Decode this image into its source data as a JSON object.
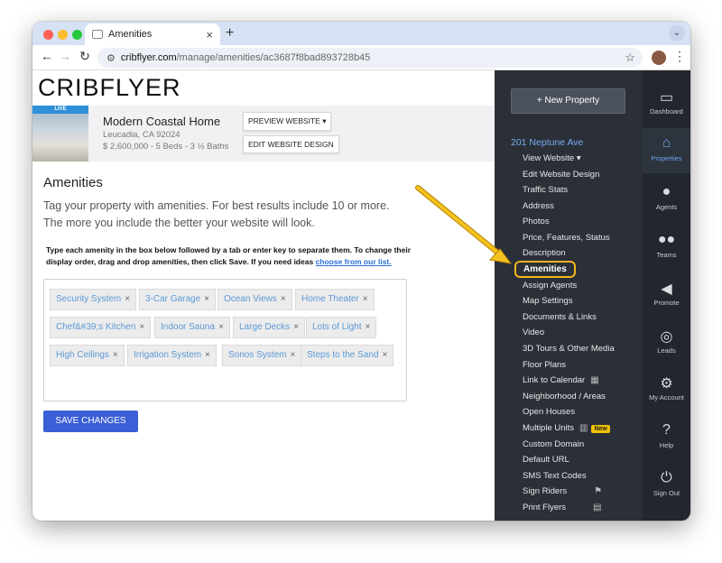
{
  "browser": {
    "tab_title": "Amenities",
    "new_tab": "+",
    "url_host": "cribflyer.com",
    "url_path": "/manage/amenities/ac3687f8bad893728b45"
  },
  "brand": {
    "logo": "CRIBFLYER"
  },
  "property": {
    "badge": "LIVE",
    "name": "Modern Coastal Home",
    "location": "Leucadia, CA 92024",
    "details": "$ 2,600,000 - 5 Beds - 3 ½ Baths",
    "preview_btn": "PREVIEW WEBSITE",
    "edit_btn": "EDIT WEBSITE DESIGN"
  },
  "content": {
    "heading": "Amenities",
    "intro": "Tag your property with amenities. For best results include 10 or more. The more you include the better your website will look.",
    "instructions": "Type each amenity in the box below followed by a tab or enter key to separate them. To change their display order, drag and drop amenities, then click Save. If you need ideas",
    "ideas_link": "choose from our list.",
    "tags": [
      "Security System",
      "3-Car Garage",
      "Ocean Views",
      "Home Theater",
      "Chef&#39;s Kitchen",
      "Indoor Sauna",
      "Large Decks",
      "Lots of Light",
      "High Ceilings",
      "Irrigation System",
      "Sonos System",
      "Steps to the Sand"
    ],
    "tag_remove": "×",
    "save_label": "SAVE CHANGES"
  },
  "sidebar": {
    "new_property": "+ New Property",
    "address": "201 Neptune Ave",
    "items": [
      "View Website",
      "Edit Website Design",
      "Traffic Stats",
      "Address",
      "Photos",
      "Price, Features, Status",
      "Description",
      "Amenities",
      "Assign Agents",
      "Map Settings",
      "Documents & Links",
      "Video",
      "3D Tours & Other Media",
      "Floor Plans",
      "Link to Calendar",
      "Neighborhood / Areas",
      "Open Houses",
      "Multiple Units",
      "Custom Domain",
      "Default URL",
      "SMS Text Codes",
      "Sign Riders",
      "Print Flyers"
    ],
    "new_badge": "New",
    "active_item": "Amenities"
  },
  "rail": [
    "Dashboard",
    "Properties",
    "Agents",
    "Teams",
    "Promote",
    "Leads",
    "My Account",
    "Help",
    "Sign Out"
  ],
  "colors": {
    "accent": "#3b5fd6",
    "highlight": "#f2b51e",
    "sidebar_bg": "#2b3038",
    "rail_bg": "#22262d",
    "link": "#76aaf0"
  }
}
